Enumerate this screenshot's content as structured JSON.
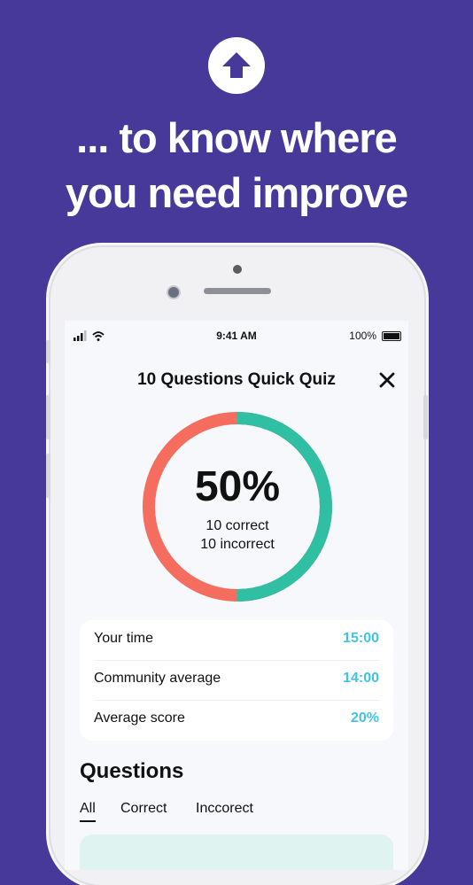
{
  "promo": {
    "headline_line1": "... to know where",
    "headline_line2": "you need improve",
    "icon": "arrow-up-icon"
  },
  "status_bar": {
    "time": "9:41 AM",
    "battery": "100%"
  },
  "quiz": {
    "title": "10 Questions Quick Quiz",
    "close_icon": "close-icon",
    "score_percent": "50%",
    "correct_text": "10 correct",
    "incorrect_text": "10 incorrect",
    "correct_fraction": 0.5
  },
  "stats": [
    {
      "label": "Your time",
      "value": "15:00"
    },
    {
      "label": "Community average",
      "value": "14:00"
    },
    {
      "label": "Average score",
      "value": "20%"
    }
  ],
  "questions": {
    "heading": "Questions",
    "filters": [
      "All",
      "Correct",
      "Inccorect"
    ]
  },
  "colors": {
    "background": "#47399a",
    "correct": "#2fbfa2",
    "incorrect": "#f46d5e",
    "stat_value": "#41c3e6"
  }
}
